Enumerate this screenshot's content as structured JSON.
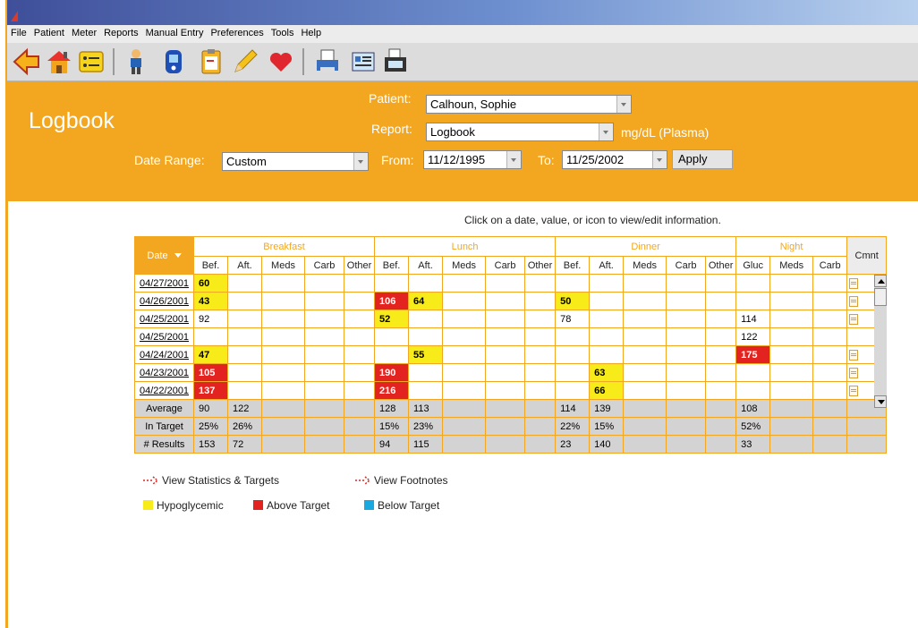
{
  "menu": [
    "File",
    "Patient",
    "Meter",
    "Reports",
    "Manual Entry",
    "Preferences",
    "Tools",
    "Help"
  ],
  "toolbar": {
    "icons": [
      "back-arrow-icon",
      "home-icon",
      "list-icon",
      "person-icon",
      "meter-device-icon",
      "clipboard-icon",
      "pencil-icon",
      "heart-icon",
      "print-icon",
      "report-icon",
      "fax-icon"
    ]
  },
  "header": {
    "title": "Logbook",
    "patient_label": "Patient:",
    "patient_value": "Calhoun, Sophie",
    "report_label": "Report:",
    "report_value": "Logbook",
    "units": "mg/dL (Plasma)",
    "date_range_label": "Date Range:",
    "date_range_value": "Custom",
    "from_label": "From:",
    "from_value": "11/12/1995",
    "to_label": "To:",
    "to_value": "11/25/2002",
    "apply_label": "Apply"
  },
  "hint": "Click on a date, value, or icon to view/edit information.",
  "table": {
    "date_header": "Date",
    "comment_header": "Cmnt",
    "groups": [
      "Breakfast",
      "Lunch",
      "Dinner",
      "Night"
    ],
    "cols": {
      "meal": [
        "Bef.",
        "Aft.",
        "Meds",
        "Carb",
        "Other"
      ],
      "night": [
        "Gluc",
        "Meds",
        "Carb"
      ]
    },
    "rows": [
      {
        "date": "04/27/2001",
        "cells": [
          [
            "60",
            "hypo"
          ],
          "",
          "",
          "",
          "",
          "",
          "",
          "",
          "",
          "",
          "",
          "",
          "",
          "",
          "",
          "",
          "",
          ""
        ],
        "note": true
      },
      {
        "date": "04/26/2001",
        "cells": [
          [
            "43",
            "hypo"
          ],
          "",
          "",
          "",
          "",
          [
            "106",
            "above"
          ],
          [
            "64",
            "hypo"
          ],
          "",
          "",
          "",
          [
            "50",
            "hypo"
          ],
          "",
          "",
          "",
          "",
          "",
          "",
          ""
        ],
        "note": true
      },
      {
        "date": "04/25/2001",
        "cells": [
          "92",
          "",
          "",
          "",
          "",
          [
            "52",
            "hypo"
          ],
          "",
          "",
          "",
          "",
          "78",
          "",
          "",
          "",
          "",
          "114",
          "",
          ""
        ],
        "note": true
      },
      {
        "date": "04/25/2001",
        "cells": [
          "",
          "",
          "",
          "",
          "",
          "",
          "",
          "",
          "",
          "",
          "",
          "",
          "",
          "",
          "",
          "122",
          "",
          ""
        ],
        "note": false
      },
      {
        "date": "04/24/2001",
        "cells": [
          [
            "47",
            "hypo"
          ],
          "",
          "",
          "",
          "",
          "",
          [
            "55",
            "hypo"
          ],
          "",
          "",
          "",
          "",
          "",
          "",
          "",
          "",
          [
            "175",
            "above"
          ],
          "",
          ""
        ],
        "note": true
      },
      {
        "date": "04/23/2001",
        "cells": [
          [
            "105",
            "above"
          ],
          "",
          "",
          "",
          "",
          [
            "190",
            "above"
          ],
          "",
          "",
          "",
          "",
          "",
          [
            "63",
            "hypo"
          ],
          "",
          "",
          "",
          "",
          "",
          ""
        ],
        "note": true
      },
      {
        "date": "04/22/2001",
        "cells": [
          [
            "137",
            "above"
          ],
          "",
          "",
          "",
          "",
          [
            "216",
            "above"
          ],
          "",
          "",
          "",
          "",
          "",
          [
            "66",
            "hypo"
          ],
          "",
          "",
          "",
          "",
          "",
          ""
        ],
        "note": true
      }
    ],
    "summary": [
      {
        "label": "Average",
        "cells": [
          "90",
          "122",
          "",
          "",
          "",
          "128",
          "113",
          "",
          "",
          "",
          "114",
          "139",
          "",
          "",
          "",
          "108",
          "",
          ""
        ]
      },
      {
        "label": "In Target",
        "cells": [
          "25%",
          "26%",
          "",
          "",
          "",
          "15%",
          "23%",
          "",
          "",
          "",
          "22%",
          "15%",
          "",
          "",
          "",
          "52%",
          "",
          ""
        ]
      },
      {
        "label": "# Results",
        "cells": [
          "153",
          "72",
          "",
          "",
          "",
          "94",
          "115",
          "",
          "",
          "",
          "23",
          "140",
          "",
          "",
          "",
          "33",
          "",
          ""
        ]
      }
    ]
  },
  "links": {
    "stats": "View Statistics & Targets",
    "footnotes": "View Footnotes"
  },
  "legend": {
    "hypo": "Hypoglycemic",
    "above": "Above Target",
    "below": "Below Target",
    "colors": {
      "hypo": "#f7ec1a",
      "above": "#e3231f",
      "below": "#1aa8e0",
      "accent": "#f3a720"
    }
  }
}
